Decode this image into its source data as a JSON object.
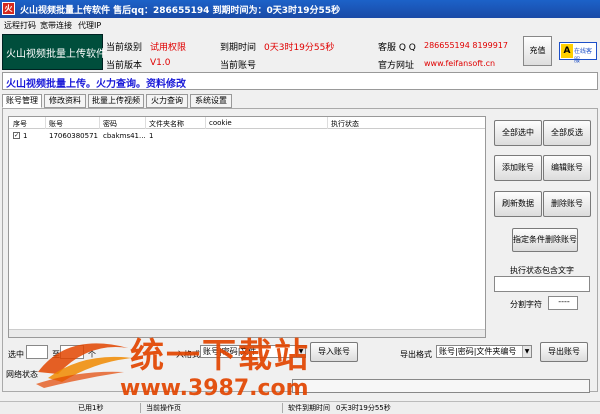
{
  "window": {
    "title": "火山视频批量上传软件 售后qq：286655194 到期时间为：0天3时19分55秒"
  },
  "menu": [
    "远程打码",
    "宽带连接",
    "代理IP"
  ],
  "logo": {
    "text": "火山视频批量上传软件"
  },
  "info": {
    "level_label": "当前级别",
    "level_value": "试用权限",
    "expire_label": "到期时间",
    "expire_value": "0天3时19分55秒",
    "support_label": "客服 Q Q",
    "support_value": "286655194 8199917",
    "version_label": "当前版本",
    "version_value": "V1.0",
    "account_label": "当前账号",
    "site_label": "官方网址",
    "site_value": "www.feifansoft.cn"
  },
  "recharge_button": "充值",
  "help_logo": {
    "a": "A",
    "b": "在线客服"
  },
  "slogan": "火山视频批量上传。火力查询。资料修改",
  "tabs": [
    "账号管理",
    "修改资料",
    "批量上传视频",
    "火力查询",
    "系统设置"
  ],
  "table": {
    "columns": [
      "序号",
      "账号",
      "密码",
      "文件夹名称",
      "cookie",
      "执行状态"
    ],
    "rows": [
      {
        "checked": "✓",
        "index": "1",
        "account": "17060380571",
        "password": "cbakms41...",
        "folder": "1",
        "cookie": "",
        "status": ""
      }
    ]
  },
  "buttons": {
    "select_all": "全部选中",
    "invert": "全部反选",
    "add": "添加账号",
    "edit": "编辑账号",
    "refresh": "刷新数据",
    "delete": "删除账号",
    "delete_by_condition": "指定条件删除账号",
    "import": "导入账号",
    "export": "导出账号"
  },
  "filter": {
    "status_label": "执行状态包含文字",
    "status_value": "",
    "sep_label": "分割字符",
    "sep_value": "----"
  },
  "bottom": {
    "select_label": "选中",
    "from_label": "至",
    "count_value": "个",
    "import_format_label": "入格式",
    "import_format_value": "账号|密码|文件",
    "export_format_label": "导出格式",
    "export_format_value": "账号|密码|文件夹编号"
  },
  "network_label": "网络状态",
  "statusbar": {
    "elapsed": "已用1秒",
    "op_label": "当前操作页",
    "expire_label": "软件到期时间",
    "expire_value": "0天3时19分55秒"
  },
  "watermark": {
    "main": "统一下载站",
    "url": "www.3987.com"
  },
  "colors": {
    "title_bar": "#1a4aa6",
    "accent_red": "#e00000",
    "logo_bg": "#004e3c",
    "slogan_blue": "#1a1ad8",
    "watermark": "#e24500"
  }
}
